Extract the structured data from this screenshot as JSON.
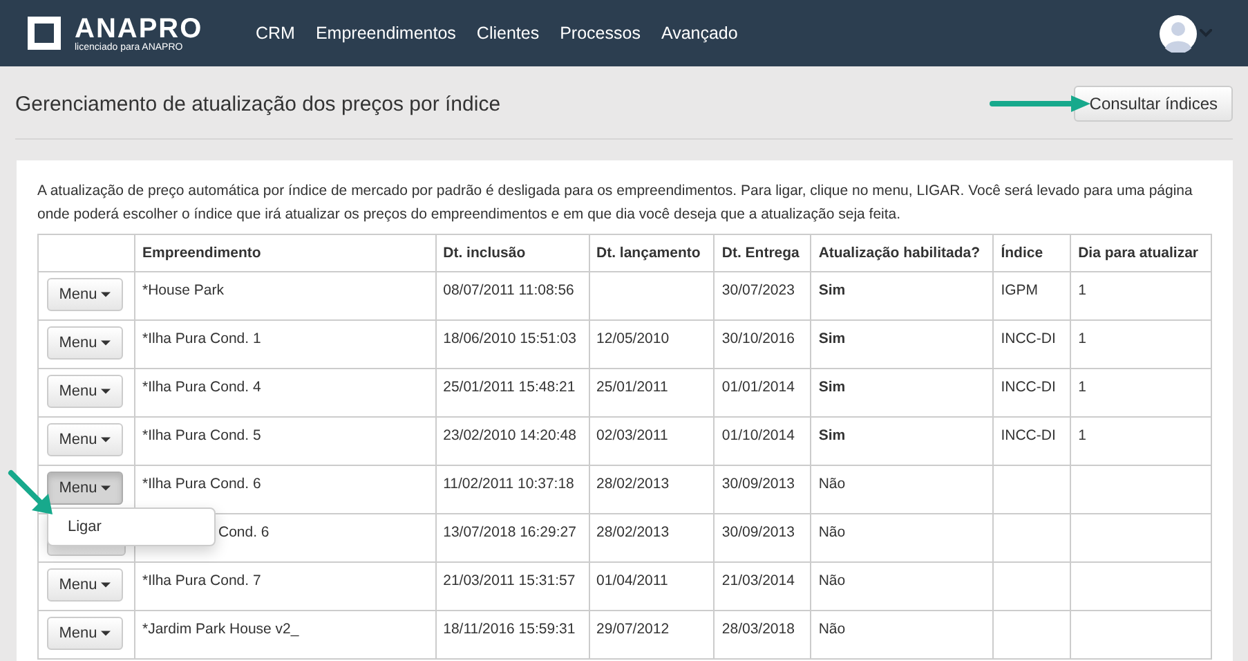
{
  "navbar": {
    "logo": "ANAPRO",
    "logo_subtitle": "licenciado para ANAPRO",
    "menu": [
      "CRM",
      "Empreendimentos",
      "Clientes",
      "Processos",
      "Avançado"
    ]
  },
  "page": {
    "title": "Gerenciamento de atualização dos preços por índice",
    "action_button": "Consultar índices"
  },
  "intro": "A atualização de preço automática por índice de mercado por padrão é desligada para os empreendimentos. Para ligar, clique no menu, LIGAR. Você será levado para uma página onde poderá escolher o índice que irá atualizar os preços do empreendimentos e em que dia você deseja que a atualização seja feita.",
  "table": {
    "columns": [
      "Empreendimento",
      "Dt. inclusão",
      "Dt. lançamento",
      "Dt. Entrega",
      "Atualização habilitada?",
      "Índice",
      "Dia para atualizar"
    ],
    "rows": [
      {
        "menu": "Menu",
        "menu_open": false,
        "covered": false,
        "cells": [
          "*House Park",
          "08/07/2011 11:08:56",
          "",
          "30/07/2023",
          "Sim",
          "IGPM",
          "1"
        ],
        "enabled": true
      },
      {
        "menu": "Menu",
        "menu_open": false,
        "covered": false,
        "cells": [
          "*Ilha Pura Cond. 1",
          "18/06/2010 15:51:03",
          "12/05/2010",
          "30/10/2016",
          "Sim",
          "INCC-DI",
          "1"
        ],
        "enabled": true
      },
      {
        "menu": "Menu",
        "menu_open": false,
        "covered": false,
        "cells": [
          "*Ilha Pura Cond. 4",
          "25/01/2011 15:48:21",
          "25/01/2011",
          "01/01/2014",
          "Sim",
          "INCC-DI",
          "1"
        ],
        "enabled": true
      },
      {
        "menu": "Menu",
        "menu_open": false,
        "covered": false,
        "cells": [
          "*Ilha Pura Cond. 5",
          "23/02/2010 14:20:48",
          "02/03/2011",
          "01/10/2014",
          "Sim",
          "INCC-DI",
          "1"
        ],
        "enabled": true
      },
      {
        "menu": "Menu",
        "menu_open": true,
        "covered": false,
        "cells": [
          "*Ilha Pura Cond. 6",
          "11/02/2011 10:37:18",
          "28/02/2013",
          "30/09/2013",
          "Não",
          "",
          ""
        ],
        "enabled": false,
        "dropdown": [
          "Ligar"
        ]
      },
      {
        "menu": "",
        "menu_open": false,
        "covered": true,
        "cells": [
          "Cond. 6",
          "13/07/2018 16:29:27",
          "28/02/2013",
          "30/09/2013",
          "Não",
          "",
          ""
        ],
        "enabled": false
      },
      {
        "menu": "Menu",
        "menu_open": false,
        "covered": false,
        "cells": [
          "*Ilha Pura Cond. 7",
          "21/03/2011 15:31:57",
          "01/04/2011",
          "21/03/2014",
          "Não",
          "",
          ""
        ],
        "enabled": false
      },
      {
        "menu": "Menu",
        "menu_open": false,
        "covered": false,
        "cells": [
          "*Jardim Park House v2_",
          "18/11/2016 15:59:31",
          "29/07/2012",
          "28/03/2018",
          "Não",
          "",
          ""
        ],
        "enabled": false
      }
    ]
  }
}
